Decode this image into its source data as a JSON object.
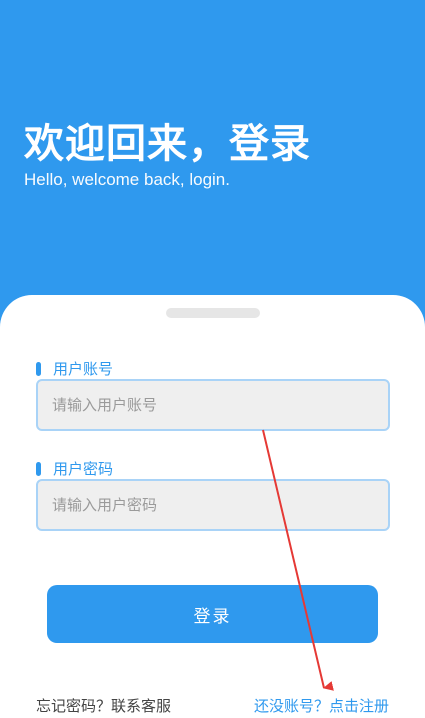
{
  "header": {
    "title": "欢迎回来，登录",
    "subtitle": "Hello, welcome back, login."
  },
  "form": {
    "account_label": "用户账号",
    "account_placeholder": "请输入用户账号",
    "password_label": "用户密码",
    "password_placeholder": "请输入用户密码",
    "login_label": "登录"
  },
  "footer": {
    "forgot": "忘记密码？联系客服",
    "register": "还没账号？点击注册"
  },
  "colors": {
    "primary": "#2f99ee",
    "annotation_arrow": "#e53935"
  }
}
